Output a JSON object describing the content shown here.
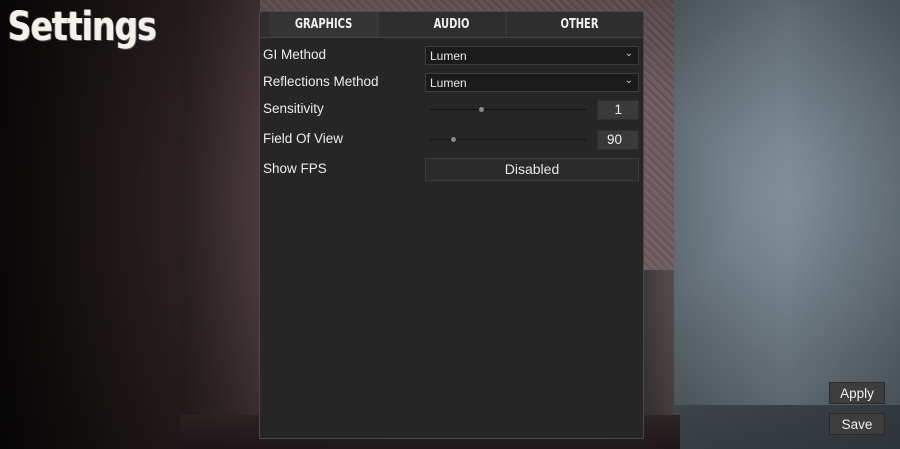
{
  "title": "Settings",
  "tabs": [
    {
      "label": "GRAPHICS",
      "active": true
    },
    {
      "label": "AUDIO",
      "active": false
    },
    {
      "label": "OTHER",
      "active": false
    }
  ],
  "settings": {
    "gi_method": {
      "label": "GI Method",
      "value": "Lumen"
    },
    "reflections_method": {
      "label": "Reflections Method",
      "value": "Lumen"
    },
    "sensitivity": {
      "label": "Sensitivity",
      "value": "1",
      "slider_fraction": 0.33
    },
    "field_of_view": {
      "label": "Field Of View",
      "value": "90",
      "slider_fraction": 0.15
    },
    "show_fps": {
      "label": "Show FPS",
      "value": "Disabled"
    }
  },
  "buttons": {
    "apply": "Apply",
    "save": "Save"
  },
  "icons": {
    "dropdown_arrow": "chevron-down-icon"
  },
  "colors": {
    "panel_bg": "#262626",
    "text": "#ececec",
    "button_bg": "#3d3d3d"
  }
}
